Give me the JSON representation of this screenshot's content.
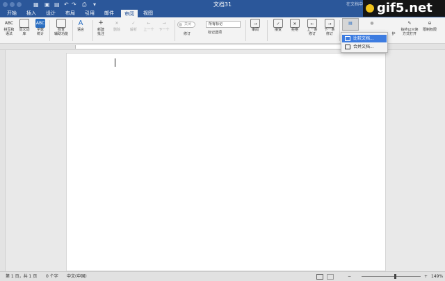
{
  "title": "文档31",
  "search_placeholder": "在文档中搜索",
  "tabs": [
    "开始",
    "插入",
    "设计",
    "布局",
    "引用",
    "邮件",
    "审阅",
    "视图"
  ],
  "active_tab": "审阅",
  "ribbon": {
    "spelling": "拼写和\n语法",
    "thesaurus": "同义词\n库",
    "wordcount": "字数\n统计",
    "accessibility": "检查\n辅助功能",
    "language": "语言",
    "new_comment": "新建\n批注",
    "delete": "删除",
    "resolve": "解析",
    "prev": "上一个",
    "next": "下一个",
    "track_toggle": "关闭",
    "track": "修订",
    "markup_select": "所有标记",
    "markup_options": "标记选项",
    "review": "审阅",
    "accept": "接受",
    "reject": "拒绝",
    "prev_change": "上一条\n修订",
    "next_change": "下一条\n修订",
    "protect": "护",
    "readonly": "始终以只读\n方式打开",
    "restrict": "限制权限"
  },
  "compare_menu": {
    "compare": "比较文档...",
    "combine": "合并文档..."
  },
  "status": {
    "page": "第 1 页，共 1 页",
    "words": "0 个字",
    "language": "中文(中国)",
    "zoom": "149%"
  },
  "watermark": "gif5.net",
  "colors": {
    "brand": "#2b579a",
    "menu_highlight": "#3d7ce0"
  }
}
